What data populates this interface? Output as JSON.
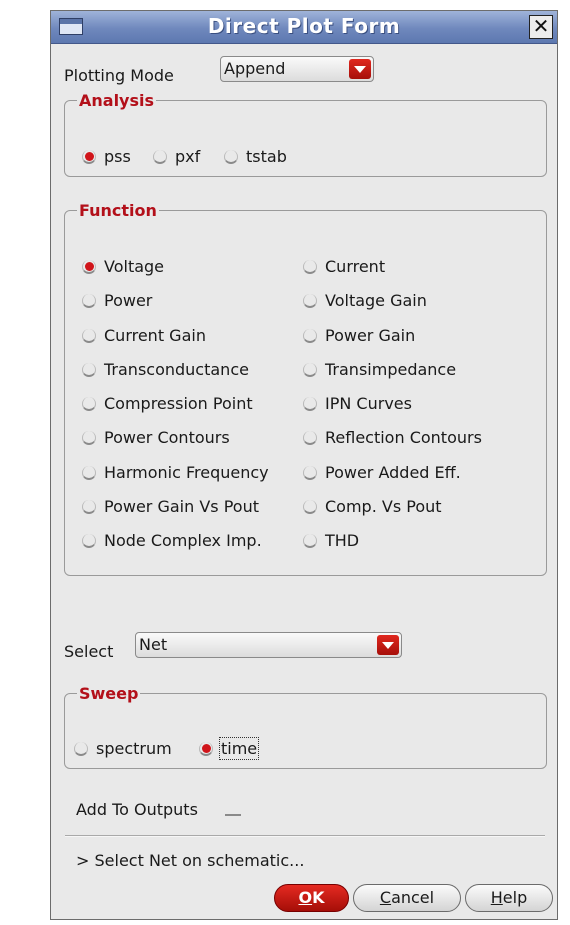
{
  "window": {
    "title": "Direct Plot Form",
    "close_glyph": "✕"
  },
  "plotting_mode": {
    "label": "Plotting Mode",
    "value": "Append"
  },
  "analysis": {
    "title": "Analysis",
    "options": [
      {
        "label": "pss",
        "selected": true
      },
      {
        "label": "pxf",
        "selected": false
      },
      {
        "label": "tstab",
        "selected": false
      }
    ]
  },
  "function": {
    "title": "Function",
    "left": [
      {
        "label": "Voltage",
        "selected": true
      },
      {
        "label": "Power",
        "selected": false
      },
      {
        "label": "Current Gain",
        "selected": false
      },
      {
        "label": "Transconductance",
        "selected": false
      },
      {
        "label": "Compression Point",
        "selected": false
      },
      {
        "label": "Power Contours",
        "selected": false
      },
      {
        "label": "Harmonic Frequency",
        "selected": false
      },
      {
        "label": "Power Gain Vs Pout",
        "selected": false
      },
      {
        "label": "Node Complex Imp.",
        "selected": false
      }
    ],
    "right": [
      {
        "label": "Current",
        "selected": false
      },
      {
        "label": "Voltage Gain",
        "selected": false
      },
      {
        "label": "Power Gain",
        "selected": false
      },
      {
        "label": "Transimpedance",
        "selected": false
      },
      {
        "label": "IPN Curves",
        "selected": false
      },
      {
        "label": "Reflection Contours",
        "selected": false
      },
      {
        "label": "Power Added Eff.",
        "selected": false
      },
      {
        "label": "Comp. Vs Pout",
        "selected": false
      },
      {
        "label": "THD",
        "selected": false
      }
    ]
  },
  "select": {
    "label": "Select",
    "value": "Net"
  },
  "sweep": {
    "title": "Sweep",
    "options": [
      {
        "label": "spectrum",
        "selected": false
      },
      {
        "label": "time",
        "selected": true
      }
    ]
  },
  "add_to_outputs": {
    "label": "Add To Outputs",
    "checked": false
  },
  "status_text": "> Select Net on schematic...",
  "buttons": {
    "ok": {
      "mnemonic": "O",
      "rest": "K"
    },
    "cancel": {
      "mnemonic": "C",
      "rest": "ancel"
    },
    "help": {
      "mnemonic": "H",
      "rest": "elp"
    }
  },
  "colors": {
    "accent_red": "#d0141a",
    "group_title": "#b3101a",
    "titlebar": "#6f88bd"
  }
}
